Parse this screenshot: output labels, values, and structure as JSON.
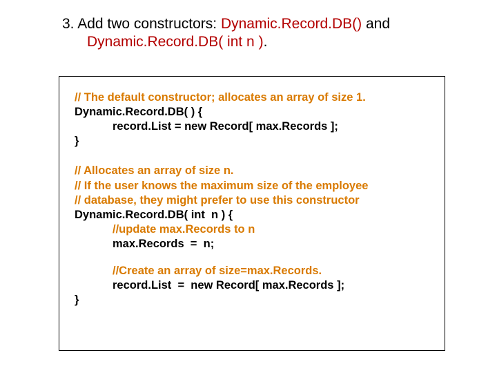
{
  "title": {
    "prefix": "3.  Add two constructors: ",
    "ctor1": "Dynamic.Record.DB()",
    "mid": " and",
    "ctor2": "Dynamic.Record.DB( int n )",
    "tail": "."
  },
  "code": {
    "b1_c1": "// The default constructor; allocates an array of size 1.",
    "b1_l2_a": "Dynamic.Record.DB(",
    "b1_l2_b": " ) {",
    "b1_l3": "            record.List = new Record[ max.Records ];",
    "b1_l4": "}",
    "b2_c1": "// Allocates an array of size n.",
    "b2_c2": "// If the user knows the maximum size of the employee",
    "b2_c3": "// database, they might prefer to use this constructor",
    "b2_l4_a": "Dynamic.Record.DB(",
    "b2_l4_b": " int  n ) {",
    "b2_c5": "            //update max.Records to n",
    "b2_l6": "            max.Records  =  n;",
    "b2_c7": "            //Create an array of size=max.Records.",
    "b2_l8": "            record.List  =  new Record[ max.Records ];",
    "b2_l9": "}"
  }
}
